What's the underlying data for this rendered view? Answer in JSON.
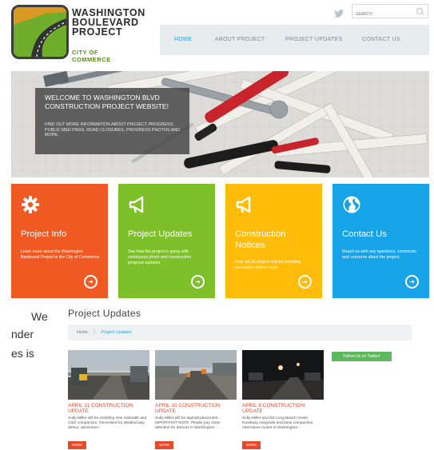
{
  "logo": {
    "line1": "WASHINGTON",
    "line2": "BOULEVARD",
    "line3": "PROJECT",
    "city": "CITY OF COMMERCE"
  },
  "header": {
    "search_placeholder": "SEARCH",
    "nav": [
      "HOME",
      "ABOUT PROJECT",
      "PROJECT UPDATES",
      "CONTACT US"
    ],
    "active_nav": "HOME"
  },
  "hero": {
    "title": "WELCOME TO WASHINGTON BLVD CONSTRUCTION PROJECT WEBSITE!",
    "text": "FIND OUT MORE INFORMATION ABOUT PROJECT PROGRESS, PUBLIC MEETINGS, ROAD CLOSURES, PROGRESS PHOTOS AND MORE."
  },
  "tiles": [
    {
      "title": "Project Info",
      "text": "Learn more about the Washington Boulevard Project in the City of Commerce.",
      "color": "#f05a22",
      "icon": "gear-icon"
    },
    {
      "title": "Project Updates",
      "text": "See how the project is going with continuous photo and construction progress updates.",
      "color": "#7dc02a",
      "icon": "megaphone-icon"
    },
    {
      "title": "Construction Notices",
      "text": "Find out all project notices including necessary detour maps",
      "color": "#ffbd0a",
      "icon": "megaphone-icon"
    },
    {
      "title": "Contact Us",
      "text": "Reach us with any questions, comments and concerns about the project.",
      "color": "#17a3e8",
      "icon": "globe-icon"
    }
  ],
  "side_text": {
    "line1": "We",
    "line2": "nder",
    "line3": "es  is"
  },
  "updates": {
    "title": "Project Updates",
    "breadcrumb": [
      "Home",
      "/",
      "Project Updates"
    ],
    "cta": "Follow Us on Twitter!",
    "cards": [
      {
        "title": "APRIL 11 CONSTRUCTION UPDATE",
        "text": "Sully-Miller will be installing new Sidewalk and C&G compaction. Generated for detailed pay detour, advisories...",
        "more": "MORE"
      },
      {
        "title": "APRIL 10 CONSTRUCTION UPDATE",
        "text": "Sully-Miller will be asphalt placement. IMPORTANT NOTE: Please pay close attention for detours in Washington...",
        "more": "MORE"
      },
      {
        "title": "APRIL 8 CONSTRUCTION UPDATE",
        "text": "Sully-Miller and the Long Beach crews: Roadway subgrade and base compaction. Alternative routes to Washington...",
        "more": "MORE"
      }
    ]
  }
}
